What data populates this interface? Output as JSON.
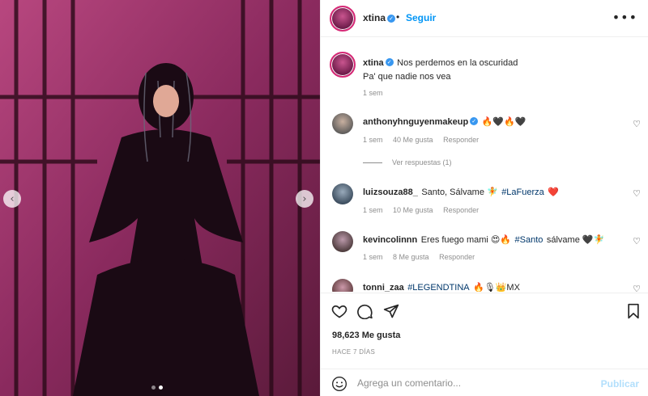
{
  "post_header": {
    "username": "xtina",
    "separator": "•",
    "follow_label": "Seguir",
    "more_icon": "more-options-icon"
  },
  "caption": {
    "username": "xtina",
    "line1": "Nos perdemos en la oscuridad",
    "line2": "Pa' que nadie nos vea",
    "time": "1 sem"
  },
  "comments": [
    {
      "username": "anthonyhnguyenmakeup",
      "verified": true,
      "text": "🔥🖤🔥🖤",
      "time": "1 sem",
      "likes": "40 Me gusta",
      "reply": "Responder",
      "view_replies": "Ver respuestas (1)"
    },
    {
      "username": "luizsouza88_",
      "text_before": "Santo, Sálvame 🧚",
      "hashtag": "#LaFuerza",
      "text_after": "❤️",
      "time": "1 sem",
      "likes": "10 Me gusta",
      "reply": "Responder"
    },
    {
      "username": "kevincolinnn",
      "text_before": "Eres fuego mami 😍🔥",
      "hashtag": "#Santo",
      "text_after": "sálvame 🖤🧚",
      "time": "1 sem",
      "likes": "8 Me gusta",
      "reply": "Responder"
    },
    {
      "username": "tonni_zaa",
      "hashtag": "#LEGENDTINA",
      "text_after": "🔥🎙👑MX"
    }
  ],
  "post_stats": {
    "likes": "98,623 Me gusta",
    "ago": "HACE 7 DÍAS"
  },
  "comment_box": {
    "placeholder": "Agrega un comentario...",
    "publish_label": "Publicar"
  },
  "carousel": {
    "current": 2,
    "total": 2
  },
  "colors": {
    "accent": "#0095f6",
    "verified": "#3897f0",
    "hashtag": "#00376b",
    "muted": "#8e8e8e",
    "photo_tint": "#a33a73"
  }
}
